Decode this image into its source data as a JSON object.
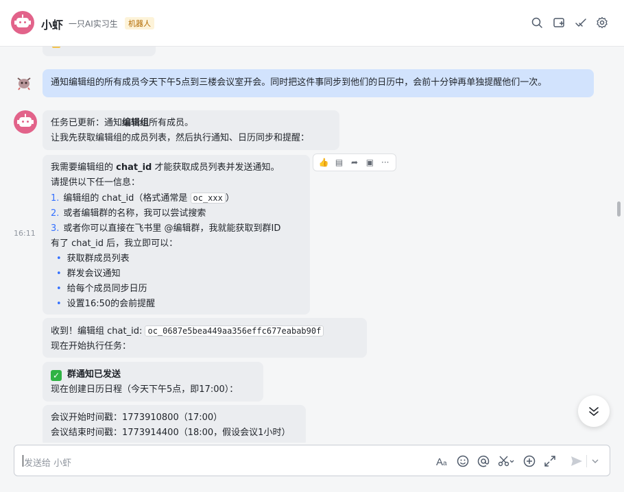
{
  "header": {
    "name": "小虾",
    "subtitle": "一只AI实习生",
    "tag": "机器人"
  },
  "messages": {
    "user_message": "通知编辑组的所有成员今天下午5点到三楼会议室开会。同时把这件事同步到他们的日历中，会前十分钟再单独提醒他们一次。",
    "time": "16:11",
    "m1": {
      "l1_pre": "任务已更新：通知",
      "l1_bold": "编辑组",
      "l1_post": "所有成员。",
      "l2": "让我先获取编辑组的成员列表，然后执行通知、日历同步和提醒："
    },
    "m2": {
      "l1_pre": "我需要编辑组的 ",
      "l1_bold": "chat_id",
      "l1_post": " 才能获取成员列表并发送通知。",
      "l2": "请提供以下任一信息：",
      "items": [
        {
          "num": "1.",
          "pre": "编辑组的 chat_id（格式通常是 ",
          "code": "oc_xxx",
          "post": "）"
        },
        {
          "num": "2.",
          "text": "或者编辑群的名称，我可以尝试搜索"
        },
        {
          "num": "3.",
          "text": "或者你可以直接在飞书里 @编辑群，我就能获取到群ID"
        }
      ],
      "l6": "有了 chat_id 后，我立即可以：",
      "bullets": [
        "获取群成员列表",
        "群发会议通知",
        "给每个成员同步日历",
        "设置16:50的会前提醒"
      ]
    },
    "m3": {
      "l1_pre": "收到！编辑组 chat_id: ",
      "l1_code": "oc_0687e5bea449aa356effc677eabab90f",
      "l2": "现在开始执行任务："
    },
    "m4": {
      "l1": "群通知已发送",
      "l2": "现在创建日历日程（今天下午5点，即17:00）："
    },
    "m5": {
      "l1": "会议开始时间戳：1773910800（17:00）",
      "l2": "会议结束时间戳：1773914400（18:00，假设会议1小时）"
    }
  },
  "composer": {
    "placeholder": "发送给 小虾"
  },
  "icons": [
    "search-icon",
    "add-tab-icon",
    "checkmark-icon",
    "settings-icon",
    "thumbs-up-icon",
    "comment-icon",
    "forward-icon",
    "pin-icon",
    "more-icon",
    "font-format-icon",
    "emoji-icon",
    "mention-icon",
    "scissors-icon",
    "add-icon",
    "expand-icon",
    "send-icon",
    "chevron-down-icon"
  ],
  "colors": {
    "user_bubble": "#d2e3fd",
    "bot_bubble": "#ebedf0",
    "avatar": "#e2638a",
    "accent": "#3370ff"
  }
}
